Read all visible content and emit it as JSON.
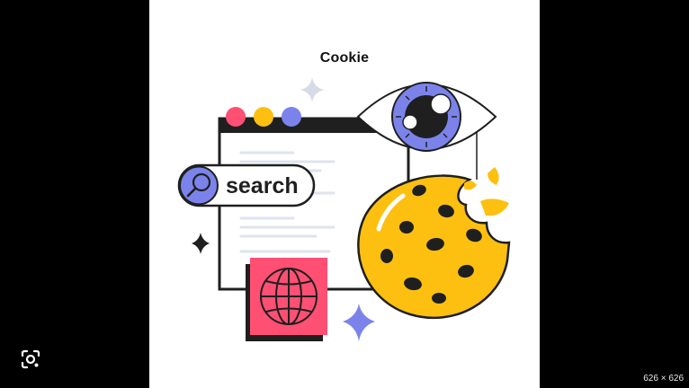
{
  "illustration": {
    "title": "Cookie",
    "search_label": "search",
    "colors": {
      "accent_purple": "#7b83eb",
      "cookie_yellow": "#fdc010",
      "pink": "#ff4f73",
      "dark": "#1f1f1f"
    }
  },
  "viewer": {
    "dimensions": "626 × 626",
    "lens_icon": "google-lens-icon"
  }
}
